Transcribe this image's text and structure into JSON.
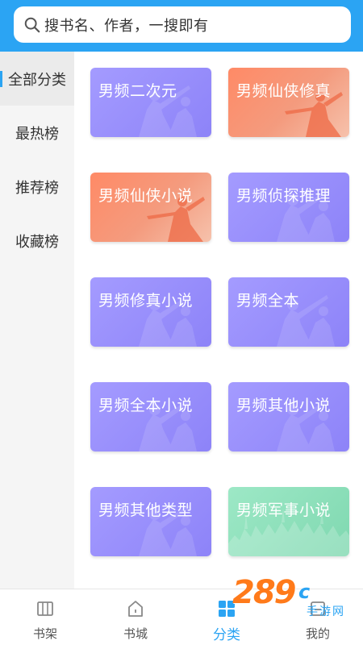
{
  "search": {
    "placeholder": "搜书名、作者，一搜即有"
  },
  "sidebar": {
    "items": [
      {
        "label": "全部分类",
        "active": true
      },
      {
        "label": "最热榜",
        "active": false
      },
      {
        "label": "推荐榜",
        "active": false
      },
      {
        "label": "收藏榜",
        "active": false
      }
    ]
  },
  "categories": [
    {
      "label": "男频二次元",
      "theme": "purple"
    },
    {
      "label": "男频仙侠修真",
      "theme": "orange"
    },
    {
      "label": "男频仙侠小说",
      "theme": "orange"
    },
    {
      "label": "男频侦探推理",
      "theme": "purple"
    },
    {
      "label": "男频修真小说",
      "theme": "purple"
    },
    {
      "label": "男频全本",
      "theme": "purple"
    },
    {
      "label": "男频全本小说",
      "theme": "purple"
    },
    {
      "label": "男频其他小说",
      "theme": "purple"
    },
    {
      "label": "男频其他类型",
      "theme": "purple"
    },
    {
      "label": "男频军事小说",
      "theme": "green"
    }
  ],
  "tabbar": {
    "items": [
      {
        "label": "书架",
        "icon": "bookshelf-icon",
        "active": false
      },
      {
        "label": "书城",
        "icon": "home-icon",
        "active": false
      },
      {
        "label": "分类",
        "icon": "category-icon",
        "active": true
      },
      {
        "label": "我的",
        "icon": "profile-icon",
        "active": false
      }
    ]
  },
  "watermark": {
    "number": "289",
    "suffix": "c",
    "subtitle": "手游网"
  },
  "colors": {
    "accent": "#2ba4f3",
    "card_purple": "#988ffc",
    "card_orange": "#f7896a",
    "card_green": "#8fe0bc"
  }
}
